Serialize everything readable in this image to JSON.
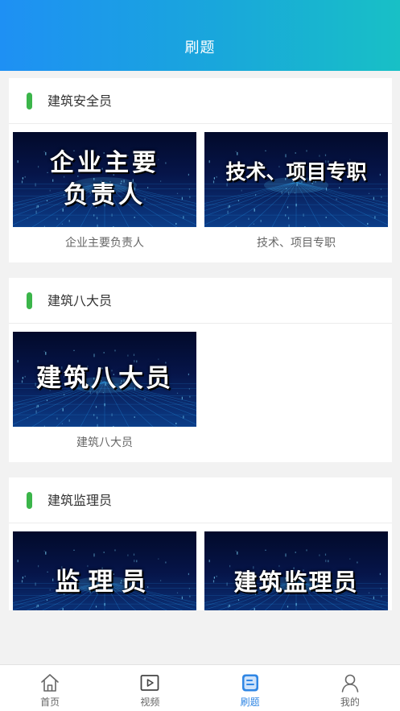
{
  "header": {
    "title": "刷题"
  },
  "sections": [
    {
      "title": "建筑安全员",
      "cards": [
        {
          "thumb_text": "企业主要负责人",
          "thumb_lines": [
            "企业主要",
            "负责人"
          ],
          "caption": "企业主要负责人"
        },
        {
          "thumb_text": "技术、项目专职",
          "thumb_lines": [
            "技术、项目专职"
          ],
          "caption": "技术、项目专职"
        }
      ]
    },
    {
      "title": "建筑八大员",
      "cards": [
        {
          "thumb_text": "建筑八大员",
          "thumb_lines": [
            "建筑八大员"
          ],
          "caption": "建筑八大员"
        }
      ]
    },
    {
      "title": "建筑监理员",
      "cards": [
        {
          "thumb_text": "监理员",
          "thumb_lines": [
            "监理员"
          ],
          "caption": ""
        },
        {
          "thumb_text": "建筑监理员",
          "thumb_lines": [
            "建筑监理员"
          ],
          "caption": ""
        }
      ]
    }
  ],
  "tabbar": {
    "items": [
      {
        "label": "首页",
        "icon": "home-icon"
      },
      {
        "label": "视频",
        "icon": "video-icon"
      },
      {
        "label": "刷题",
        "icon": "quiz-icon",
        "active": true
      },
      {
        "label": "我的",
        "icon": "user-icon"
      }
    ]
  },
  "colors": {
    "accent": "#2f86e4",
    "section_bar": "#3bb54a",
    "header_gradient_start": "#1e90f4",
    "header_gradient_end": "#18c0c6"
  }
}
